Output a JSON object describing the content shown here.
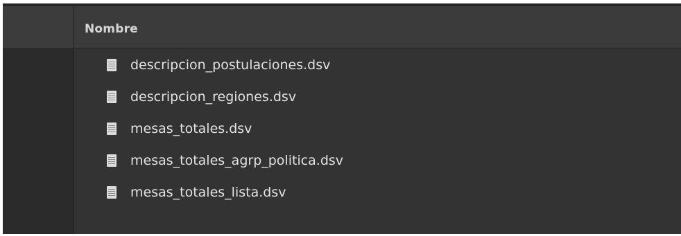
{
  "file_view": {
    "column_header": "Nombre",
    "files": [
      {
        "name": "descripcion_postulaciones.dsv",
        "icon": "text-file-icon"
      },
      {
        "name": "descripcion_regiones.dsv",
        "icon": "text-file-icon"
      },
      {
        "name": "mesas_totales.dsv",
        "icon": "text-file-icon"
      },
      {
        "name": "mesas_totales_agrp_politica.dsv",
        "icon": "text-file-icon"
      },
      {
        "name": "mesas_totales_lista.dsv",
        "icon": "text-file-icon"
      }
    ]
  },
  "colors": {
    "background": "#333333",
    "header": "#3b3b3b",
    "text": "#e2e2e2"
  }
}
